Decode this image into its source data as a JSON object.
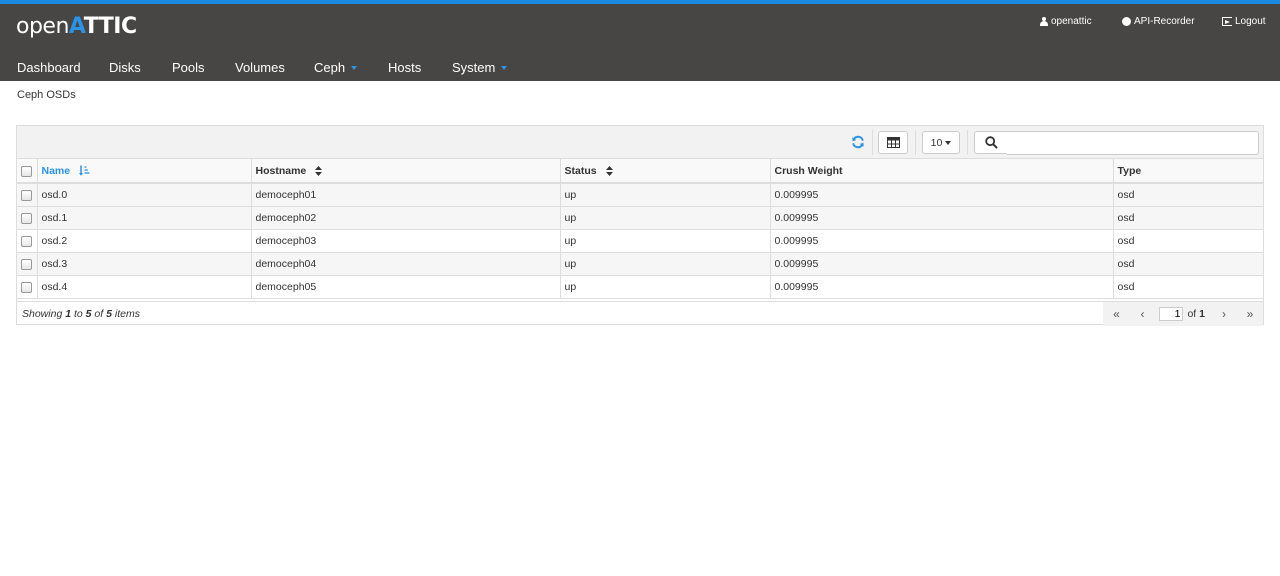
{
  "app": {
    "logo_light": "open",
    "logo_a": "A",
    "logo_bold": "TTIC"
  },
  "user_menu": {
    "user": "openattic",
    "api_recorder": "API-Recorder",
    "logout": "Logout"
  },
  "nav": {
    "dashboard": "Dashboard",
    "disks": "Disks",
    "pools": "Pools",
    "volumes": "Volumes",
    "ceph": "Ceph",
    "hosts": "Hosts",
    "system": "System"
  },
  "breadcrumb": "Ceph OSDs",
  "toolbar": {
    "page_size": "10",
    "search_value": "",
    "search_placeholder": ""
  },
  "table": {
    "columns": [
      "Name",
      "Hostname",
      "Status",
      "Crush Weight",
      "Type"
    ],
    "rows": [
      [
        "osd.0",
        "democeph01",
        "up",
        "0.009995",
        "osd"
      ],
      [
        "osd.1",
        "democeph02",
        "up",
        "0.009995",
        "osd"
      ],
      [
        "osd.2",
        "democeph03",
        "up",
        "0.009995",
        "osd"
      ],
      [
        "osd.3",
        "democeph04",
        "up",
        "0.009995",
        "osd"
      ],
      [
        "osd.4",
        "democeph05",
        "up",
        "0.009995",
        "osd"
      ]
    ]
  },
  "footer": {
    "showing_prefix": "Showing",
    "from": "1",
    "to_word": "to",
    "to": "5",
    "of_word": "of",
    "total": "5",
    "items_word": "items",
    "current_page": "1",
    "page_of": "of",
    "total_pages": "1"
  },
  "colors": {
    "accent": "#2a93e8",
    "topbar": "#474645"
  }
}
